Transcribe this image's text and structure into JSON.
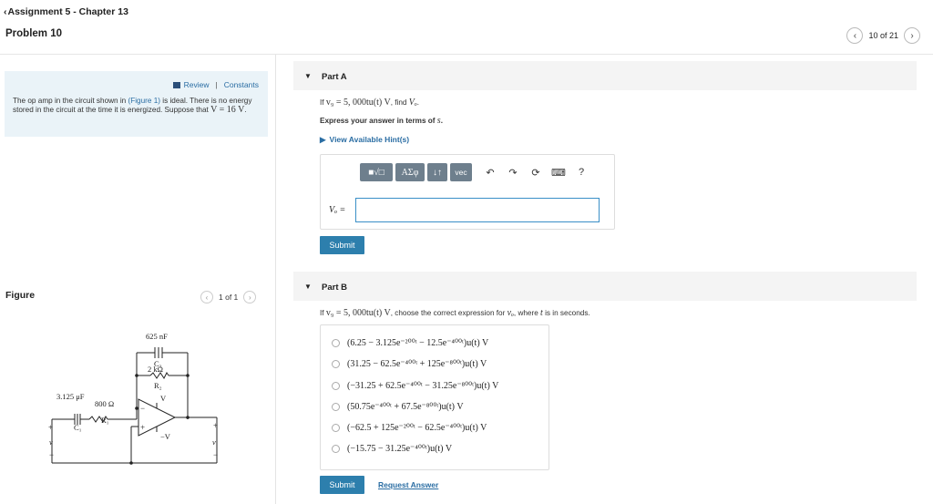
{
  "header": {
    "breadcrumb": "Assignment 5 - Chapter 13",
    "problem_title": "Problem 10",
    "pager": "10 of 21"
  },
  "problem": {
    "review": "Review",
    "constants": "Constants",
    "text_1": "The op amp in the circuit shown in ",
    "figure_link": "(Figure 1)",
    "text_2": " is ideal. There is no energy stored in the circuit at the time it is energized. Suppose that ",
    "v_math": "V = 16  V",
    "text_3": "."
  },
  "figure": {
    "label": "Figure",
    "nav": "1 of 1",
    "c2": "625 nF",
    "c2_name": "C₂",
    "r2": "2 kΩ",
    "r2_name": "R₂",
    "c1": "3.125 μF",
    "c1_name": "C₁",
    "r1": "800 Ω",
    "r1_name": "R₁",
    "vplus": "V",
    "vminus": "−V",
    "vg": "v",
    "vg_sub": "g",
    "vo": "v",
    "vo_sub": "o",
    "plus": "+",
    "minus": "−"
  },
  "part_a": {
    "title": "Part A",
    "question_prefix": "If ",
    "question_math": "v₉ = 5, 000tu(t) V",
    "question_suffix": ", find ",
    "question_var": "Vₒ",
    "question_end": ".",
    "instruction": "Express your answer in terms of ",
    "instruction_var": "s",
    "instruction_end": ".",
    "hints": "View Available Hint(s)",
    "toolbar": {
      "template": "■√□",
      "symbols": "AΣφ",
      "arrows": "↓↑",
      "vec": "vec",
      "help": "?"
    },
    "answer_label": "Vₒ =",
    "answer_value": "",
    "submit": "Submit"
  },
  "part_b": {
    "title": "Part B",
    "question_prefix": "If ",
    "question_math": "v₉ = 5, 000tu(t) V",
    "question_mid": ", choose the correct expression for ",
    "question_var": "vₒ",
    "question_mid2": ", where ",
    "question_var2": "t",
    "question_end": " is in seconds.",
    "choices": [
      "(6.25 − 3.125e⁻²⁰⁰ᵗ − 12.5e⁻⁴⁰⁰ᵗ)u(t) V",
      "(31.25 − 62.5e⁻⁴⁰⁰ᵗ + 125e⁻⁸⁰⁰ᵗ)u(t) V",
      "(−31.25 + 62.5e⁻⁴⁰⁰ᵗ − 31.25e⁻⁸⁰⁰ᵗ)u(t) V",
      "(50.75e⁻⁴⁰⁰ᵗ + 67.5e⁻⁸⁰⁰ᵗ)u(t) V",
      "(−62.5 + 125e⁻²⁰⁰ᵗ − 62.5e⁻⁴⁰⁰ᵗ)u(t) V",
      "(−15.75 − 31.25e⁻⁴⁰⁰ᵗ)u(t) V"
    ],
    "submit": "Submit",
    "request_answer": "Request Answer"
  }
}
